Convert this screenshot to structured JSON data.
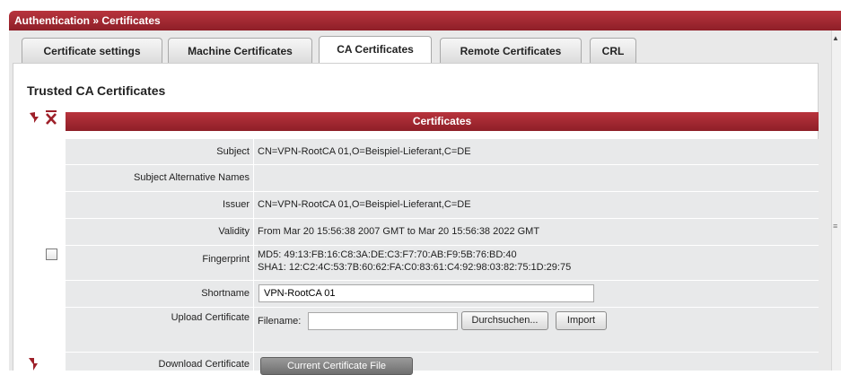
{
  "window": {
    "breadcrumb": "Authentication » Certificates"
  },
  "tabs": [
    {
      "label": "Certificate settings"
    },
    {
      "label": "Machine Certificates"
    },
    {
      "label": "CA Certificates"
    },
    {
      "label": "Remote Certificates"
    },
    {
      "label": "CRL"
    }
  ],
  "section": {
    "title": "Trusted CA Certificates"
  },
  "table": {
    "header": "Certificates",
    "rows": {
      "subject": {
        "label": "Subject",
        "value": "CN=VPN-RootCA 01,O=Beispiel-Lieferant,C=DE"
      },
      "san": {
        "label": "Subject Alternative Names",
        "value": ""
      },
      "issuer": {
        "label": "Issuer",
        "value": "CN=VPN-RootCA 01,O=Beispiel-Lieferant,C=DE"
      },
      "validity": {
        "label": "Validity",
        "value": "From Mar 20 15:56:38 2007 GMT to Mar 20 15:56:38 2022 GMT"
      },
      "fingerprint": {
        "label": "Fingerprint",
        "md5": "MD5: 49:13:FB:16:C8:3A:DE:C3:F7:70:AB:F9:5B:76:BD:40",
        "sha1": "SHA1: 12:C2:4C:53:7B:60:62:FA:C0:83:61:C4:92:98:03:82:75:1D:29:75"
      },
      "shortname": {
        "label": "Shortname",
        "value": "VPN-RootCA 01"
      },
      "upload": {
        "label": "Upload Certificate",
        "filename_label": "Filename:",
        "filename_value": "",
        "browse_label": "Durchsuchen...",
        "import_label": "Import"
      },
      "download": {
        "label": "Download Certificate",
        "button_label": "Current Certificate File"
      }
    }
  },
  "colors": {
    "accent": "#a3272f",
    "row_bg": "#e8e9ea",
    "panel_bg": "#e9e9e9"
  },
  "icons": {
    "down": "arrow-down-icon",
    "delete": "delete-x-icon"
  }
}
